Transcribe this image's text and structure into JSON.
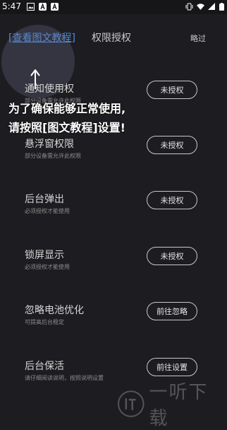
{
  "status_bar": {
    "time": "5:47",
    "icons": [
      "image-icon",
      "notification-a-icon",
      "notification-a-icon",
      "vibrate-icon",
      "wifi-icon",
      "signal-icon",
      "battery-icon"
    ]
  },
  "header": {
    "tutorial_tab": "[查看图文教程]",
    "permission_tab": "权限授权",
    "skip": "略过"
  },
  "overlay": {
    "line1": "为了确保能够正常使用,",
    "line2": "请按照[图文教程]设置!"
  },
  "permissions": [
    {
      "title": "通知使用权",
      "desc": "部分设备需允许此权限",
      "button": "未授权"
    },
    {
      "title": "悬浮窗权限",
      "desc": "部分设备需允许此权限",
      "button": "未授权"
    },
    {
      "title": "后台弹出",
      "desc": "必须授权才能使用",
      "button": "未授权"
    },
    {
      "title": "锁屏显示",
      "desc": "必须授权才能使用",
      "button": "未授权"
    },
    {
      "title": "忽略电池优化",
      "desc": "可提高后台稳定",
      "button": "前往忽略"
    },
    {
      "title": "后台保活",
      "desc": "请仔细阅读说明，按照说明设置",
      "button": "前往设置"
    }
  ],
  "watermark": {
    "text": "一听下载"
  },
  "colors": {
    "background": "#1d1d21",
    "link": "#4d8fe0",
    "button_border": "#c8c8c8"
  }
}
